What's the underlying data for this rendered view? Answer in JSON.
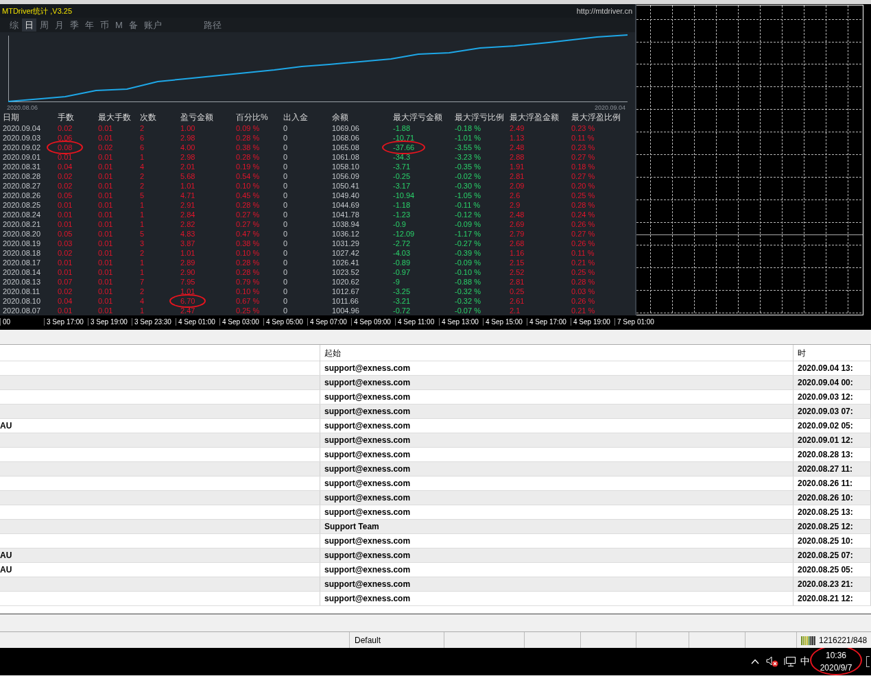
{
  "stats_panel": {
    "title": "MTDriver统计 ,V3.25",
    "link": "http://mtdriver.cn",
    "tabs": [
      {
        "label": "综",
        "selected": false
      },
      {
        "label": "日",
        "selected": true
      },
      {
        "label": "周",
        "selected": false
      },
      {
        "label": "月",
        "selected": false
      },
      {
        "label": "季",
        "selected": false
      },
      {
        "label": "年",
        "selected": false
      },
      {
        "label": "币",
        "selected": false
      },
      {
        "label": "M",
        "selected": false
      },
      {
        "label": "备",
        "selected": false
      },
      {
        "label": "账户",
        "selected": false
      },
      {
        "label": "路径",
        "selected": false
      }
    ],
    "equity_chart": {
      "start_label": "2020.08.06",
      "end_label": "2020.09.04"
    },
    "table": {
      "columns": [
        "日期",
        "手数",
        "最大手数",
        "次数",
        "盈亏金额",
        "百分比%",
        "出入金",
        "余额",
        "最大浮亏金额",
        "最大浮亏比例",
        "最大浮盈金额",
        "最大浮盈比例"
      ],
      "rows": [
        [
          "2020.09.04",
          "0.02",
          "0.01",
          "2",
          "1.00",
          "0.09 %",
          "0",
          "1069.06",
          "-1.88",
          "-0.18 %",
          "2.49",
          "0.23 %"
        ],
        [
          "2020.09.03",
          "0.06",
          "0.01",
          "6",
          "2.98",
          "0.28 %",
          "0",
          "1068.06",
          "-10.71",
          "-1.01 %",
          "1.13",
          "0.11 %"
        ],
        [
          "2020.09.02",
          {
            "text": "0.08",
            "circled": true
          },
          "0.02",
          "6",
          "4.00",
          "0.38 %",
          "0",
          "1065.08",
          {
            "text": "-37.66",
            "circled": true
          },
          "-3.55 %",
          "2.48",
          "0.23 %"
        ],
        [
          "2020.09.01",
          "0.01",
          "0.01",
          "1",
          "2.98",
          "0.28 %",
          "0",
          "1061.08",
          "-34.3",
          "-3.23 %",
          "2.88",
          "0.27 %"
        ],
        [
          "2020.08.31",
          "0.04",
          "0.01",
          "4",
          "2.01",
          "0.19 %",
          "0",
          "1058.10",
          "-3.71",
          "-0.35 %",
          "1.91",
          "0.18 %"
        ],
        [
          "2020.08.28",
          "0.02",
          "0.01",
          "2",
          "5.68",
          "0.54 %",
          "0",
          "1056.09",
          "-0.25",
          "-0.02 %",
          "2.81",
          "0.27 %"
        ],
        [
          "2020.08.27",
          "0.02",
          "0.01",
          "2",
          "1.01",
          "0.10 %",
          "0",
          "1050.41",
          "-3.17",
          "-0.30 %",
          "2.09",
          "0.20 %"
        ],
        [
          "2020.08.26",
          "0.05",
          "0.01",
          "5",
          "4.71",
          "0.45 %",
          "0",
          "1049.40",
          "-10.94",
          "-1.05 %",
          "2.6",
          "0.25 %"
        ],
        [
          "2020.08.25",
          "0.01",
          "0.01",
          "1",
          "2.91",
          "0.28 %",
          "0",
          "1044.69",
          "-1.18",
          "-0.11 %",
          "2.9",
          "0.28 %"
        ],
        [
          "2020.08.24",
          "0.01",
          "0.01",
          "1",
          "2.84",
          "0.27 %",
          "0",
          "1041.78",
          "-1.23",
          "-0.12 %",
          "2.48",
          "0.24 %"
        ],
        [
          "2020.08.21",
          "0.01",
          "0.01",
          "1",
          "2.82",
          "0.27 %",
          "0",
          "1038.94",
          "-0.9",
          "-0.09 %",
          "2.69",
          "0.26 %"
        ],
        [
          "2020.08.20",
          "0.05",
          "0.01",
          "5",
          "4.83",
          "0.47 %",
          "0",
          "1036.12",
          "-12.09",
          "-1.17 %",
          "2.79",
          "0.27 %"
        ],
        [
          "2020.08.19",
          "0.03",
          "0.01",
          "3",
          "3.87",
          "0.38 %",
          "0",
          "1031.29",
          "-2.72",
          "-0.27 %",
          "2.68",
          "0.26 %"
        ],
        [
          "2020.08.18",
          "0.02",
          "0.01",
          "2",
          "1.01",
          "0.10 %",
          "0",
          "1027.42",
          "-4.03",
          "-0.39 %",
          "1.16",
          "0.11 %"
        ],
        [
          "2020.08.17",
          "0.01",
          "0.01",
          "1",
          "2.89",
          "0.28 %",
          "0",
          "1026.41",
          "-0.89",
          "-0.09 %",
          "2.15",
          "0.21 %"
        ],
        [
          "2020.08.14",
          "0.01",
          "0.01",
          "1",
          "2.90",
          "0.28 %",
          "0",
          "1023.52",
          "-0.97",
          "-0.10 %",
          "2.52",
          "0.25 %"
        ],
        [
          "2020.08.13",
          "0.07",
          "0.01",
          "7",
          "7.95",
          "0.79 %",
          "0",
          "1020.62",
          "-9",
          "-0.88 %",
          "2.81",
          "0.28 %"
        ],
        [
          "2020.08.11",
          "0.02",
          "0.01",
          "2",
          "1.01",
          "0.10 %",
          "0",
          "1012.67",
          "-3.25",
          "-0.32 %",
          "0.25",
          "0.03 %"
        ],
        [
          "2020.08.10",
          "0.04",
          "0.01",
          "4",
          {
            "text": "6.70",
            "circled": true
          },
          "0.67 %",
          "0",
          "1011.66",
          "-3.21",
          "-0.32 %",
          "2.61",
          "0.26 %"
        ],
        [
          "2020.08.07",
          "0.01",
          "0.01",
          "1",
          "2.47",
          "0.25 %",
          "0",
          "1004.96",
          "-0.72",
          "-0.07 %",
          "2.1",
          "0.21 %"
        ]
      ]
    }
  },
  "time_axis": [
    "00",
    "3 Sep 17:00",
    "3 Sep 19:00",
    "3 Sep 23:30",
    "4 Sep 01:00",
    "4 Sep 03:00",
    "4 Sep 05:00",
    "4 Sep 07:00",
    "4 Sep 09:00",
    "4 Sep 11:00",
    "4 Sep 13:00",
    "4 Sep 15:00",
    "4 Sep 17:00",
    "4 Sep 19:00",
    "7 Sep 01:00"
  ],
  "mail_table": {
    "columns": [
      "起始",
      "时"
    ],
    "rows": [
      {
        "from": "support@exness.com",
        "time": "2020.09.04 13:"
      },
      {
        "from": "support@exness.com",
        "time": "2020.09.04 00:"
      },
      {
        "from": "support@exness.com",
        "time": "2020.09.03 12:"
      },
      {
        "from": "support@exness.com",
        "time": "2020.09.03 07:"
      },
      {
        "column_1": "AU",
        "from": "support@exness.com",
        "time": "2020.09.02 05:"
      },
      {
        "from": "support@exness.com",
        "time": "2020.09.01 12:"
      },
      {
        "from": "support@exness.com",
        "time": "2020.08.28 13:"
      },
      {
        "from": "support@exness.com",
        "time": "2020.08.27 11:"
      },
      {
        "from": "support@exness.com",
        "time": "2020.08.26 11:"
      },
      {
        "from": "support@exness.com",
        "time": "2020.08.26 10:"
      },
      {
        "from": "support@exness.com",
        "time": "2020.08.25 13:"
      },
      {
        "from": "Support Team",
        "time": "2020.08.25 12:"
      },
      {
        "from": "support@exness.com",
        "time": "2020.08.25 10:"
      },
      {
        "column_1": "AU",
        "from": "support@exness.com",
        "time": "2020.08.25 07:"
      },
      {
        "column_1": "AU",
        "from": "support@exness.com",
        "time": "2020.08.25 05:"
      },
      {
        "from": "support@exness.com",
        "time": "2020.08.23 21:"
      },
      {
        "from": "support@exness.com",
        "time": "2020.08.21 12:"
      }
    ]
  },
  "status_bar": {
    "profile": "Default",
    "connection": "1216221/848"
  },
  "taskbar": {
    "ime": "中",
    "time": "10:36",
    "date": "2020/9/7",
    "circled": true
  }
}
